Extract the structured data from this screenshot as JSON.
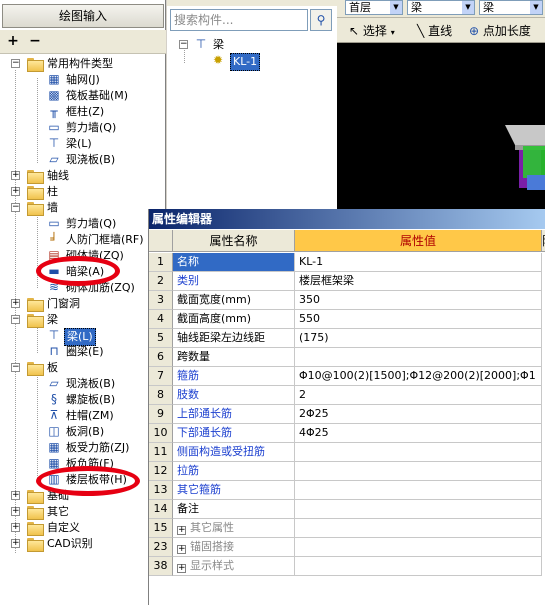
{
  "left_panel": {
    "header": "绘图输入",
    "toolbar": {
      "expand": "+",
      "collapse": "−"
    },
    "tree": {
      "common": "常用构件类型",
      "common_children": [
        "轴网(J)",
        "筏板基础(M)",
        "框柱(Z)",
        "剪力墙(Q)",
        "梁(L)",
        "现浇板(B)"
      ],
      "axis": "轴线",
      "column": "柱",
      "wall": "墙",
      "wall_children": [
        "剪力墙(Q)",
        "人防门框墙(RF)",
        "砌体墙(ZQ)",
        "暗梁(A)",
        "砌体加筋(ZQ)"
      ],
      "door_window": "门窗洞",
      "beam": "梁",
      "beam_children": [
        "梁(L)",
        "圈梁(E)"
      ],
      "slab": "板",
      "slab_children": [
        "现浇板(B)",
        "螺旋板(B)",
        "柱帽(ZM)",
        "板洞(B)",
        "板受力筋(ZJ)",
        "板负筋(F)",
        "楼层板带(H)"
      ],
      "foundation": "基础",
      "other": "其它",
      "custom": "自定义",
      "cad": "CAD识别"
    }
  },
  "mid_panel": {
    "search_placeholder": "搜索构件...",
    "tree_root": "梁",
    "tree_child": "KL-1"
  },
  "right_toolbar": {
    "combo1": "首层",
    "combo2": "梁",
    "combo3": "梁",
    "select": "选择",
    "line": "直线",
    "point_length": "点加长度"
  },
  "prop_editor": {
    "title": "属性编辑器",
    "col_name": "属性名称",
    "col_value": "属性值",
    "col_extra": "附",
    "rows": [
      {
        "num": "1",
        "name": "名称",
        "value": "KL-1"
      },
      {
        "num": "2",
        "name": "类别",
        "value": "楼层框架梁"
      },
      {
        "num": "3",
        "name": "截面宽度(mm)",
        "value": "350"
      },
      {
        "num": "4",
        "name": "截面高度(mm)",
        "value": "550"
      },
      {
        "num": "5",
        "name": "轴线距梁左边线距",
        "value": "(175)"
      },
      {
        "num": "6",
        "name": "跨数量",
        "value": ""
      },
      {
        "num": "7",
        "name": "箍筋",
        "value": "Φ10@100(2)[1500];Φ12@200(2)[2000];Φ1"
      },
      {
        "num": "8",
        "name": "肢数",
        "value": "2"
      },
      {
        "num": "9",
        "name": "上部通长筋",
        "value": "2Φ25"
      },
      {
        "num": "10",
        "name": "下部通长筋",
        "value": "4Φ25"
      },
      {
        "num": "11",
        "name": "侧面构造或受扭筋",
        "value": ""
      },
      {
        "num": "12",
        "name": "拉筋",
        "value": ""
      },
      {
        "num": "13",
        "name": "其它箍筋",
        "value": ""
      },
      {
        "num": "14",
        "name": "备注",
        "value": ""
      },
      {
        "num": "15",
        "name": "其它属性",
        "value": ""
      },
      {
        "num": "23",
        "name": "锚固搭接",
        "value": ""
      },
      {
        "num": "38",
        "name": "显示样式",
        "value": ""
      }
    ]
  }
}
